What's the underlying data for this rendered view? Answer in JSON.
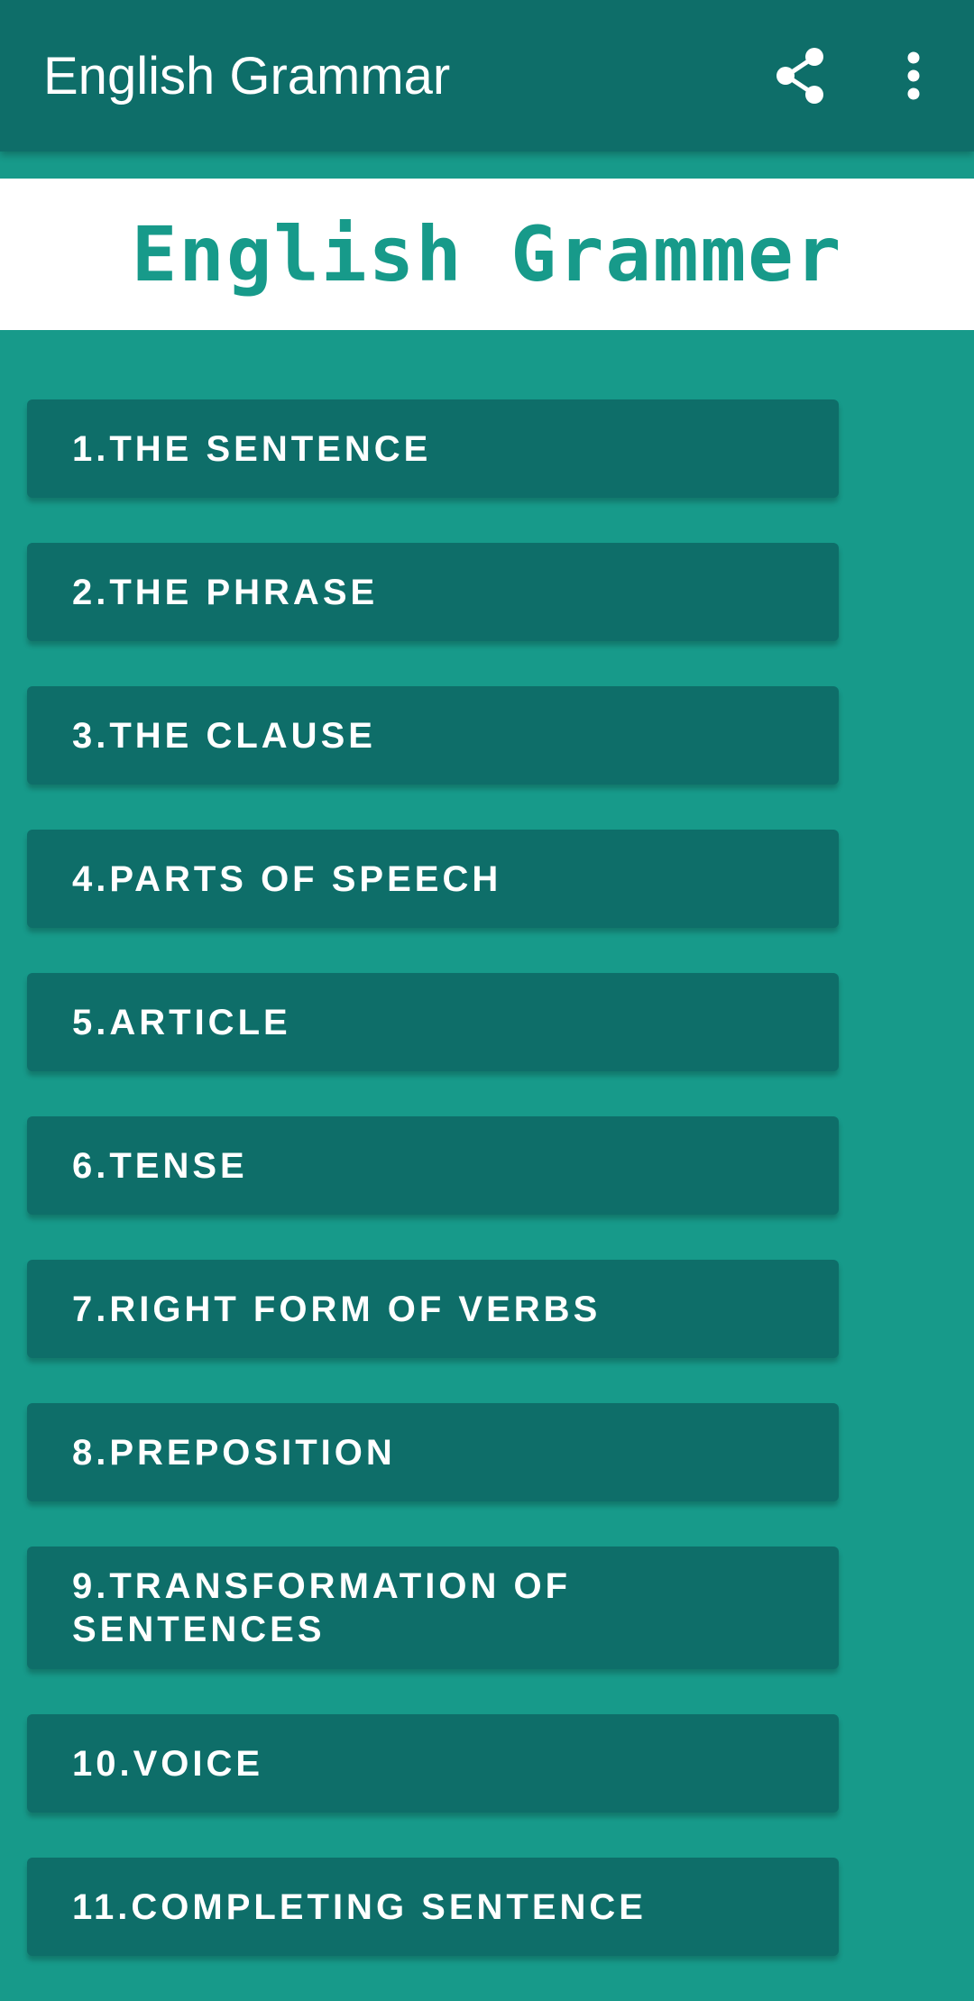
{
  "app_bar": {
    "title": "English Grammar",
    "actions": [
      {
        "icon": "share-icon"
      },
      {
        "icon": "more-vert-icon"
      }
    ]
  },
  "banner": {
    "text": "English Grammer",
    "color": "#179a8a"
  },
  "colors": {
    "app_bar": "#0e6e69",
    "background": "#179a8a",
    "item": "#0e6e69",
    "item_text": "#ffffff"
  },
  "topics": [
    {
      "label": "1.THE SENTENCE"
    },
    {
      "label": "2.THE PHRASE"
    },
    {
      "label": "3.THE CLAUSE"
    },
    {
      "label": "4.PARTS OF SPEECH"
    },
    {
      "label": "5.ARTICLE"
    },
    {
      "label": "6.TENSE"
    },
    {
      "label": "7.RIGHT FORM OF VERBS"
    },
    {
      "label": "8.PREPOSITION"
    },
    {
      "label": "9.TRANSFORMATION OF SENTENCES"
    },
    {
      "label": "10.VOICE"
    },
    {
      "label": "11.COMPLETING SENTENCE"
    }
  ]
}
